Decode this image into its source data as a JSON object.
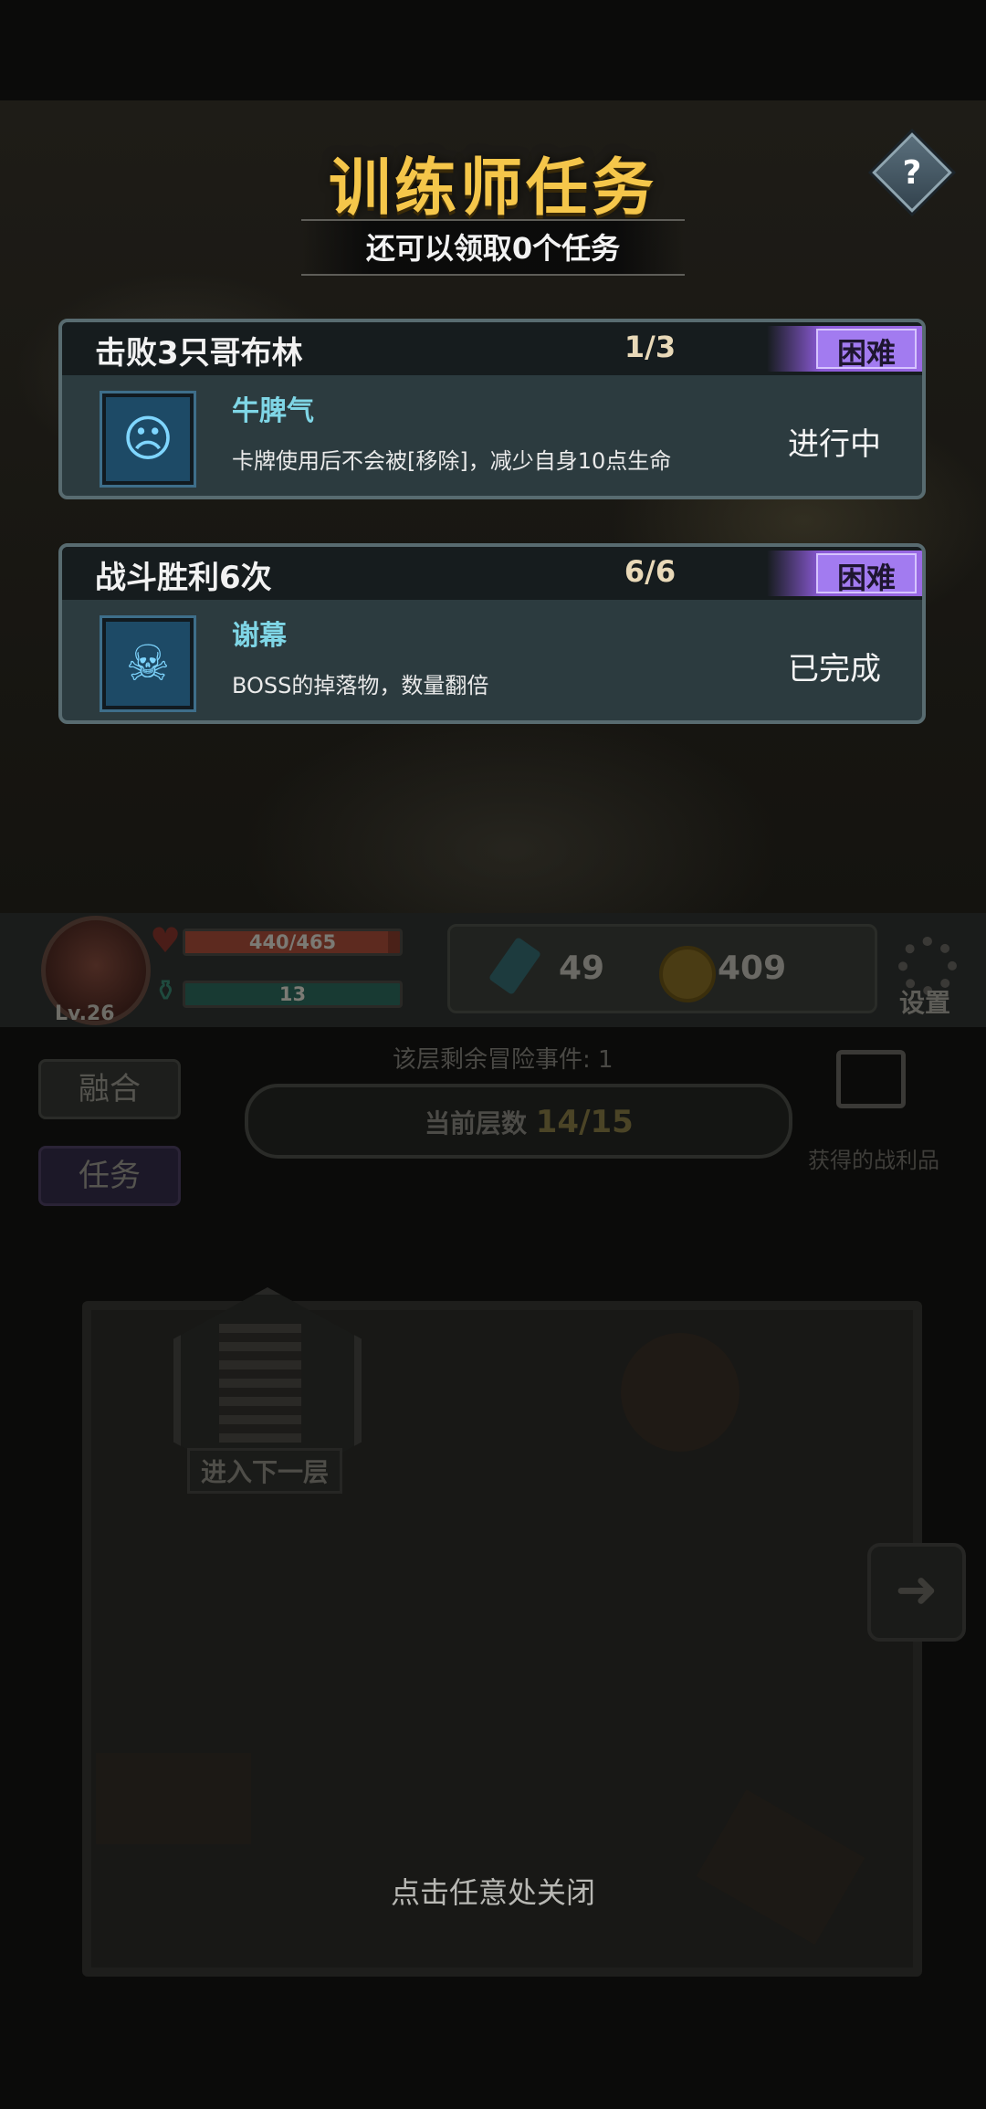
{
  "dialog": {
    "title": "训练师任务",
    "subtitle": "还可以领取0个任务",
    "help_label": "?",
    "close_hint": "点击任意处关闭"
  },
  "tasks": [
    {
      "title": "击败3只哥布林",
      "progress": "1/3",
      "difficulty": "困难",
      "reward_icon": "demon-head-icon",
      "reward_name": "牛脾气",
      "reward_desc": "卡牌使用后不会被[移除]，减少自身10点生命",
      "status": "进行中"
    },
    {
      "title": "战斗胜利6次",
      "progress": "6/6",
      "difficulty": "困难",
      "reward_icon": "reaper-icon",
      "reward_name": "谢幕",
      "reward_desc": "BOSS的掉落物，数量翻倍",
      "status": "已完成"
    }
  ],
  "hud": {
    "level": "Lv.26",
    "hp": "440/465",
    "hp_fraction": 0.946,
    "mana": "13",
    "crystals": "49",
    "coins": "409",
    "settings_label": "设置"
  },
  "side_buttons": {
    "fuse": "融合",
    "task": "任务"
  },
  "floor": {
    "events_label": "该层剩余冒险事件: 1",
    "current_label": "当前层数",
    "current_value": "14/15",
    "spoils_label": "获得的战利品",
    "next_floor_label": "进入下一层"
  },
  "colors": {
    "title_gold": "#f5c64a",
    "difficulty_purple": "#a27bf0",
    "reward_cyan": "#7fd6e6",
    "card_bg": "#2c3b3f"
  }
}
